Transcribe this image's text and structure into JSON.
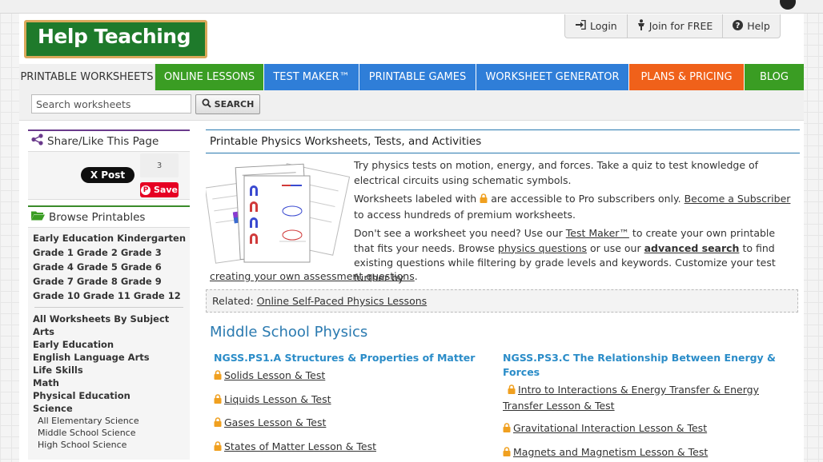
{
  "header": {
    "logo_text": "Help Teaching",
    "user_links": [
      {
        "label": "Login",
        "icon": "login-icon"
      },
      {
        "label": "Join for FREE",
        "icon": "person-icon"
      },
      {
        "label": "Help",
        "icon": "help-icon"
      }
    ]
  },
  "nav": {
    "items": [
      {
        "label": "PRINTABLE WORKSHEETS",
        "color": "#f0f0f0",
        "active": true
      },
      {
        "label": "ONLINE LESSONS",
        "color": "#3a9d23"
      },
      {
        "label": "TEST MAKER™",
        "color": "#2f7ed8"
      },
      {
        "label": "PRINTABLE GAMES",
        "color": "#2f7ed8"
      },
      {
        "label": "WORKSHEET GENERATOR",
        "color": "#2f7ed8"
      },
      {
        "label": "PLANS & PRICING",
        "color": "#f0611a"
      },
      {
        "label": "BLOG",
        "color": "#3a9d23"
      }
    ]
  },
  "search": {
    "placeholder": "Search worksheets",
    "button_label": "SEARCH"
  },
  "sidebar": {
    "share_title": "Share/Like This Page",
    "tweet_label": "X Post",
    "pin_count": "3",
    "pin_save_label": "Save",
    "browse_title": "Browse Printables",
    "grade_rows": [
      "Early Education Kindergarten",
      "Grade 1 Grade 2 Grade 3",
      "Grade 4 Grade 5 Grade 6",
      "Grade 7 Grade 8 Grade 9",
      "Grade 10 Grade 11 Grade 12"
    ],
    "subjects": [
      "All Worksheets By Subject",
      "Arts",
      "Early Education",
      "English Language Arts",
      "Life Skills",
      "Math",
      "Physical Education",
      "Science"
    ],
    "science_sub": [
      "All Elementary Science",
      "Middle School Science",
      "High School Science"
    ]
  },
  "main": {
    "title": "Printable Physics Worksheets, Tests, and Activities",
    "intro_p1": "Try physics tests on motion, energy, and forces. Take a quiz to test knowledge of electrical circuits using schematic symbols.",
    "intro_p2_a": "Worksheets labeled with",
    "intro_p2_b": "are accessible to Pro subscribers only.",
    "intro_p2_link": "Become a Subscriber",
    "intro_p2_c": "to access hundreds of premium worksheets.",
    "intro_p3_a": "Don't see a worksheet you need? Use our",
    "intro_p3_link1": "Test Maker™",
    "intro_p3_b": "to create your own printable that fits your needs. Browse",
    "intro_p3_link2": "physics questions",
    "intro_p3_c": "or use our",
    "intro_p3_link3": "advanced search",
    "intro_p3_d": "to find existing questions while filtering by grade levels and keywords. Customize your test further by",
    "intro_p3_link4": "creating your own assessment questions",
    "intro_p3_e": ".",
    "related_label": "Related:",
    "related_link": "Online Self-Paced Physics Lessons",
    "section_title": "Middle School Physics",
    "col1_head": "NGSS.PS1.A Structures & Properties of Matter",
    "col1_lessons": [
      "Solids Lesson & Test",
      "Liquids Lesson & Test",
      "Gases Lesson & Test",
      "States of Matter Lesson & Test"
    ],
    "col2_head": "NGSS.PS3.C The Relationship Between Energy & Forces",
    "col2_lessons": [
      "Intro to Interactions & Energy Transfer & Energy Transfer Lesson & Test",
      "Gravitational Interaction Lesson & Test",
      "Magnets and Magnetism Lesson & Test"
    ]
  }
}
